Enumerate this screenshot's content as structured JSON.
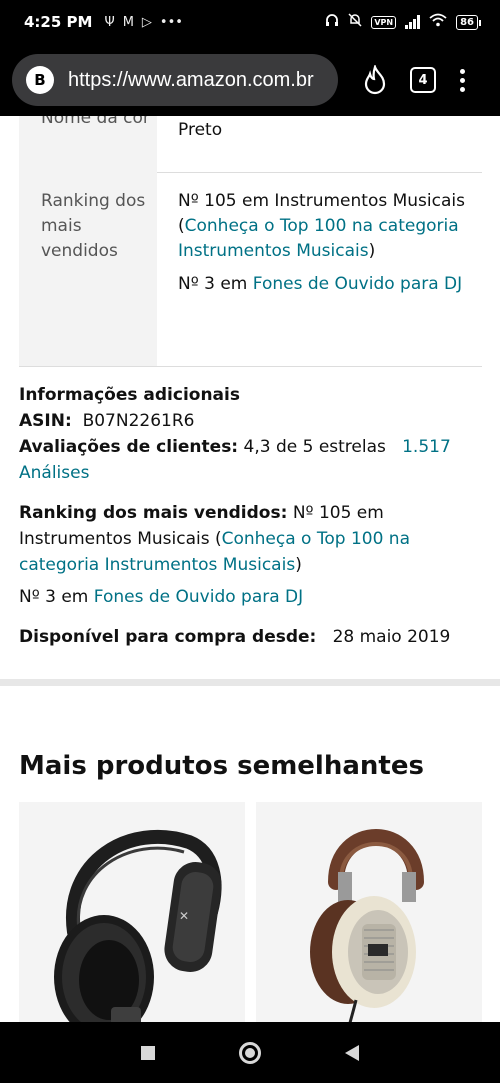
{
  "status": {
    "time": "4:25 PM",
    "vpn": "VPN",
    "battery": "86"
  },
  "browser": {
    "site_badge": "B",
    "url": "https://www.amazon.com.br",
    "tab_count": "4"
  },
  "spec_table": {
    "rows": [
      {
        "label": "Nome da cor",
        "value": "Preto"
      },
      {
        "label": "Ranking dos mais vendidos",
        "rank1_text": "Nº 105 em Instrumentos Musicais (",
        "rank1_link": "Conheça o Top 100 na categoria Instrumentos Musicais",
        "rank1_close": ")",
        "rank2_text": "Nº 3 em ",
        "rank2_link": "Fones de Ouvido para DJ"
      }
    ]
  },
  "additional_info": {
    "heading": "Informações adicionais",
    "asin_label": "ASIN:",
    "asin_value": "B07N2261R6",
    "reviews_label": "Avaliações de clientes:",
    "reviews_value": "4,3 de 5 estrelas",
    "reviews_link": "1.517 Análises",
    "ranking_label": "Ranking dos mais vendidos:",
    "ranking_text": "Nº 105 em Instrumentos Musicais (",
    "ranking_link": "Conheça o Top 100 na categoria Instrumentos Musicais",
    "ranking_close": ")",
    "rank2_text": "Nº 3 em ",
    "rank2_link": "Fones de Ouvido para DJ",
    "available_label": "Disponível para compra desde:",
    "available_value": "28 maio 2019"
  },
  "similar": {
    "title": "Mais produtos semelhantes",
    "products": [
      {
        "image": "black-over-ear-headphones"
      },
      {
        "image": "cream-brown-open-back-headphones"
      }
    ]
  },
  "colors": {
    "link": "#007185",
    "table_label_bg": "#f3f3f3",
    "system_bar": "#000000"
  }
}
